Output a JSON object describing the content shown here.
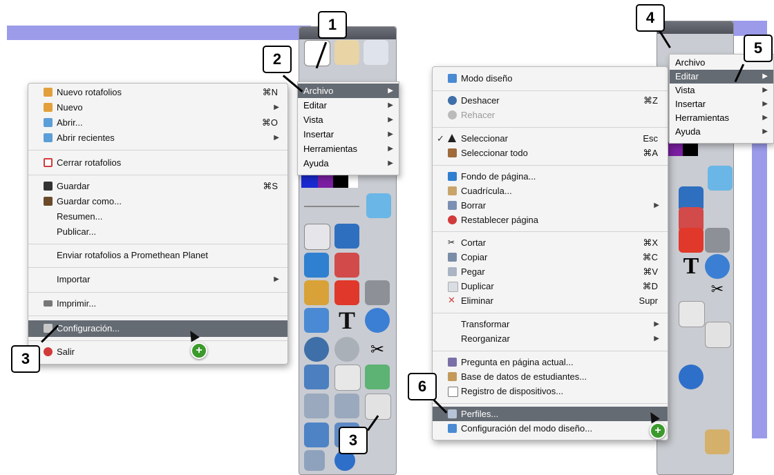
{
  "callouts": [
    "1",
    "2",
    "3",
    "3",
    "4",
    "5",
    "6"
  ],
  "menu_left": {
    "group1": [
      {
        "label": "Nuevo rotafolios",
        "shortcut": "⌘N",
        "arrow": ""
      },
      {
        "label": "Nuevo",
        "shortcut": "",
        "arrow": "▶"
      },
      {
        "label": "Abrir...",
        "shortcut": "⌘O",
        "arrow": ""
      },
      {
        "label": "Abrir recientes",
        "shortcut": "",
        "arrow": "▶"
      }
    ],
    "close": "Cerrar rotafolios",
    "group2": [
      {
        "label": "Guardar",
        "shortcut": "⌘S"
      },
      {
        "label": "Guardar como...",
        "shortcut": ""
      },
      {
        "label": "Resumen...",
        "shortcut": ""
      },
      {
        "label": "Publicar...",
        "shortcut": ""
      }
    ],
    "send": "Enviar rotafolios a Promethean Planet",
    "import": "Importar",
    "import_arrow": "▶",
    "print": "Imprimir...",
    "config": "Configuración...",
    "quit": "Salir"
  },
  "main_menu_left": {
    "items": [
      {
        "label": "Archivo",
        "arrow": "▶"
      },
      {
        "label": "Editar",
        "arrow": "▶"
      },
      {
        "label": "Vista",
        "arrow": "▶"
      },
      {
        "label": "Insertar",
        "arrow": "▶"
      },
      {
        "label": "Herramientas",
        "arrow": "▶"
      },
      {
        "label": "Ayuda",
        "arrow": "▶"
      }
    ]
  },
  "main_menu_right": {
    "items": [
      {
        "label": "Archivo",
        "arrow": ""
      },
      {
        "label": "Editar",
        "arrow": "▶"
      },
      {
        "label": "Vista",
        "arrow": "▶"
      },
      {
        "label": "Insertar",
        "arrow": "▶"
      },
      {
        "label": "Herramientas",
        "arrow": "▶"
      },
      {
        "label": "Ayuda",
        "arrow": "▶"
      }
    ]
  },
  "menu_right": {
    "design_mode": "Modo diseño",
    "undo": {
      "label": "Deshacer",
      "shortcut": "⌘Z"
    },
    "redo": {
      "label": "Rehacer",
      "shortcut": ""
    },
    "select": {
      "label": "Seleccionar",
      "shortcut": "Esc",
      "check": "✓"
    },
    "select_all": {
      "label": "Seleccionar todo",
      "shortcut": "⌘A"
    },
    "page_group": [
      {
        "label": "Fondo de página...",
        "arrow": ""
      },
      {
        "label": "Cuadrícula...",
        "arrow": ""
      },
      {
        "label": "Borrar",
        "arrow": "▶"
      },
      {
        "label": "Restablecer página",
        "arrow": ""
      }
    ],
    "clip_group": [
      {
        "label": "Cortar",
        "shortcut": "⌘X"
      },
      {
        "label": "Copiar",
        "shortcut": "⌘C"
      },
      {
        "label": "Pegar",
        "shortcut": "⌘V"
      },
      {
        "label": "Duplicar",
        "shortcut": "⌘D"
      },
      {
        "label": "Eliminar",
        "shortcut": "Supr"
      }
    ],
    "transform": {
      "label": "Transformar",
      "arrow": "▶"
    },
    "reorganize": {
      "label": "Reorganizar",
      "arrow": "▶"
    },
    "data_group": [
      "Pregunta en página actual...",
      "Base de datos de estudiantes...",
      "Registro de dispositivos..."
    ],
    "profiles": "Perfiles...",
    "design_config": "Configuración del modo diseño..."
  },
  "colors": {
    "highlight": "#656b73",
    "band": "#9b9bea",
    "menu_bg": "#f4f4f4"
  }
}
